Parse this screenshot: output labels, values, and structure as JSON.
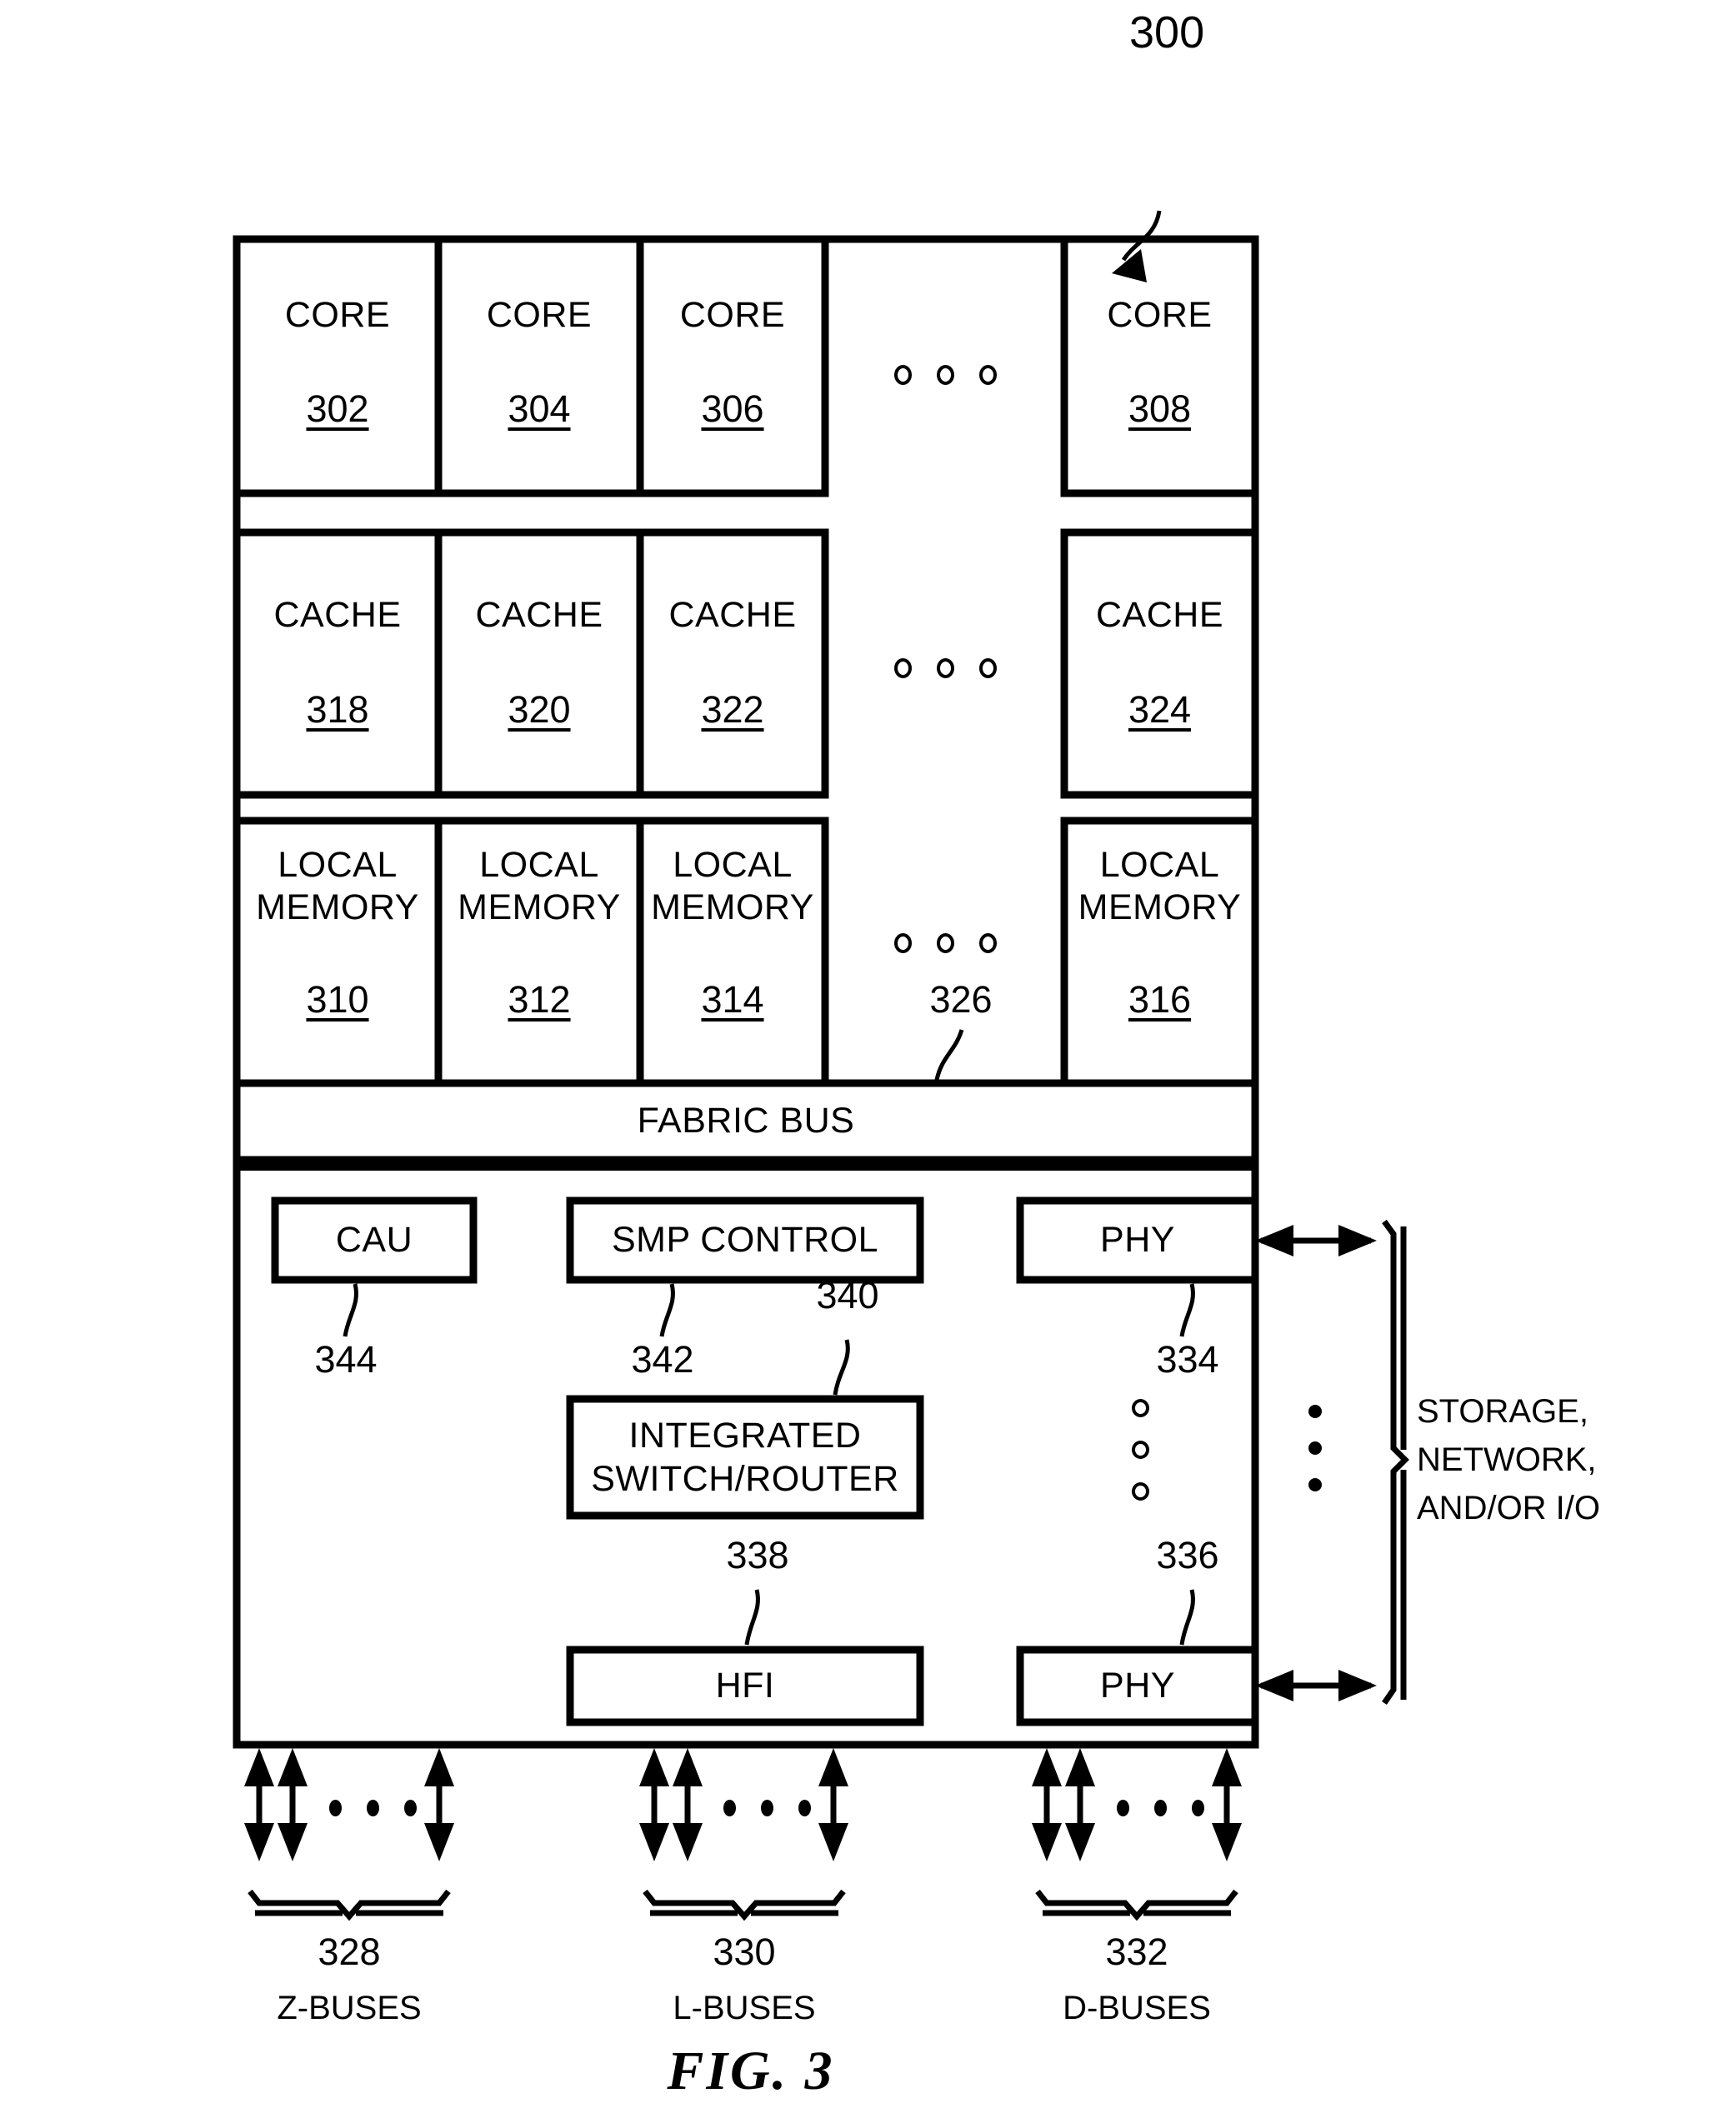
{
  "figure": {
    "caption": "FIG. 3",
    "top_reference": "300"
  },
  "diagram": {
    "core_row": {
      "boxes": [
        {
          "title": "CORE",
          "ref": "302"
        },
        {
          "title": "CORE",
          "ref": "304"
        },
        {
          "title": "CORE",
          "ref": "306"
        },
        {
          "title": "CORE",
          "ref": "308"
        }
      ],
      "ellipsis": "ooo"
    },
    "cache_row": {
      "boxes": [
        {
          "title": "CACHE",
          "ref": "318"
        },
        {
          "title": "CACHE",
          "ref": "320"
        },
        {
          "title": "CACHE",
          "ref": "322"
        },
        {
          "title": "CACHE",
          "ref": "324"
        }
      ],
      "ellipsis": "ooo"
    },
    "memory_row": {
      "boxes": [
        {
          "title_line1": "LOCAL",
          "title_line2": "MEMORY",
          "ref": "310"
        },
        {
          "title_line1": "LOCAL",
          "title_line2": "MEMORY",
          "ref": "312"
        },
        {
          "title_line1": "LOCAL",
          "title_line2": "MEMORY",
          "ref": "314"
        },
        {
          "title_line1": "LOCAL",
          "title_line2": "MEMORY",
          "ref": "316"
        }
      ],
      "ellipsis": "ooo",
      "gap_ref": "326"
    },
    "fabric_bus": {
      "label": "FABRIC BUS"
    },
    "lower_panel": {
      "cau": {
        "label": "CAU",
        "ref": "344"
      },
      "smp_control": {
        "label": "SMP CONTROL",
        "ref": "342"
      },
      "integrated_switch_router": {
        "line1": "INTEGRATED",
        "line2": "SWITCH/ROUTER",
        "ref": "340"
      },
      "hfi": {
        "label": "HFI",
        "ref": "338"
      },
      "phy_top": {
        "label": "PHY",
        "ref": "334"
      },
      "phy_bottom": {
        "label": "PHY",
        "ref": "336"
      }
    },
    "external": {
      "line1": "STORAGE,",
      "line2": "NETWORK,",
      "line3": "AND/OR I/O"
    },
    "buses": [
      {
        "ref": "328",
        "label": "Z-BUSES"
      },
      {
        "ref": "330",
        "label": "L-BUSES"
      },
      {
        "ref": "332",
        "label": "D-BUSES"
      }
    ]
  }
}
